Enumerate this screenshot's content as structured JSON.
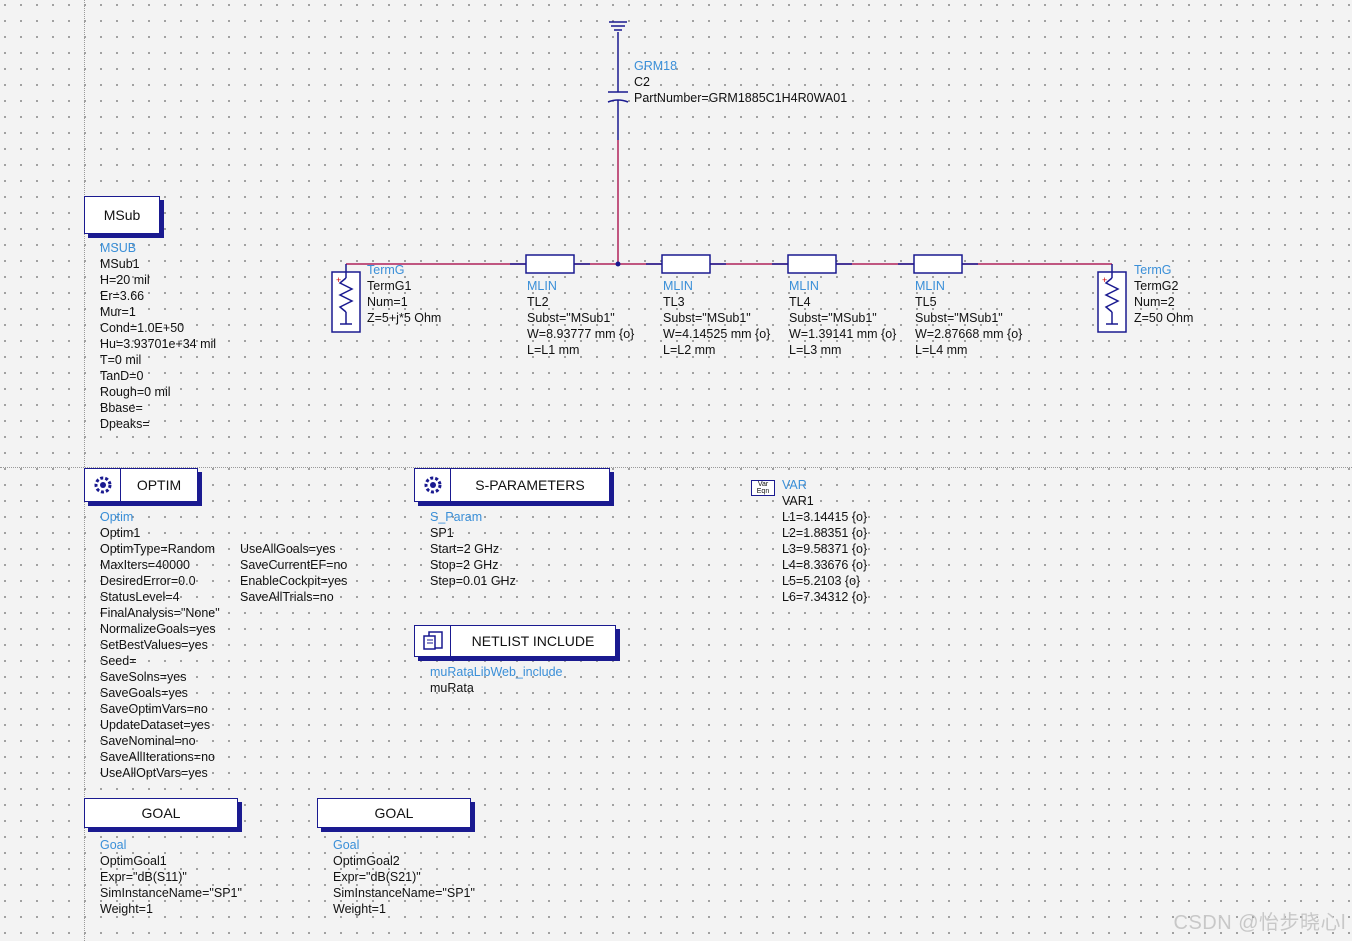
{
  "capacitor": {
    "lib": "GRM18",
    "name": "C2",
    "param": "PartNumber=GRM1885C1H4R0WA01"
  },
  "msub": {
    "box_label": "MSub",
    "lib": "MSUB",
    "name": "MSub1",
    "params": [
      "H=20 mil",
      "Er=3.66",
      "Mur=1",
      "Cond=1.0E+50",
      "Hu=3.93701e+34 mil",
      "T=0 mil",
      "TanD=0",
      "Rough=0 mil",
      "Bbase=",
      "Dpeaks="
    ]
  },
  "term1": {
    "lib": "TermG",
    "name": "TermG1",
    "params": [
      "Num=1",
      "Z=5+j*5 Ohm"
    ]
  },
  "term2": {
    "lib": "TermG",
    "name": "TermG2",
    "params": [
      "Num=2",
      "Z=50 Ohm"
    ]
  },
  "tl2": {
    "lib": "MLIN",
    "name": "TL2",
    "params": [
      "Subst=\"MSub1\"",
      "W=8.93777 mm {o}",
      "L=L1 mm"
    ]
  },
  "tl3": {
    "lib": "MLIN",
    "name": "TL3",
    "params": [
      "Subst=\"MSub1\"",
      "W=4.14525 mm {o}",
      "L=L2 mm"
    ]
  },
  "tl4": {
    "lib": "MLIN",
    "name": "TL4",
    "params": [
      "Subst=\"MSub1\"",
      "W=1.39141 mm {o}",
      "L=L3 mm"
    ]
  },
  "tl5": {
    "lib": "MLIN",
    "name": "TL5",
    "params": [
      "Subst=\"MSub1\"",
      "W=2.87668 mm {o}",
      "L=L4 mm"
    ]
  },
  "optim": {
    "box_label": "OPTIM",
    "lib": "Optim",
    "name": "Optim1",
    "col1": [
      "OptimType=Random",
      "MaxIters=40000",
      "DesiredError=0.0",
      "StatusLevel=4",
      "FinalAnalysis=\"None\"",
      "NormalizeGoals=yes",
      "SetBestValues=yes",
      "Seed=",
      "SaveSolns=yes",
      "SaveGoals=yes",
      "SaveOptimVars=no",
      "UpdateDataset=yes",
      "SaveNominal=no",
      "SaveAllIterations=no",
      "UseAllOptVars=yes"
    ],
    "col2": [
      "UseAllGoals=yes",
      "SaveCurrentEF=no",
      "EnableCockpit=yes",
      "SaveAllTrials=no"
    ]
  },
  "sparam": {
    "box_label": "S-PARAMETERS",
    "lib": "S_Param",
    "name": "SP1",
    "params": [
      "Start=2 GHz",
      "Stop=2 GHz",
      "Step=0.01 GHz"
    ]
  },
  "netlist": {
    "box_label": "NETLIST INCLUDE",
    "lib": "muRataLibWeb_include",
    "name": "muRata"
  },
  "var": {
    "icon_text": "Var Eqn",
    "lib": "VAR",
    "name": "VAR1",
    "params": [
      "L1=3.14415 {o}",
      "L2=1.88351 {o}",
      "L3=9.58371 {o}",
      "L4=8.33676 {o}",
      "L5=5.2103 {o}",
      "L6=7.34312 {o}"
    ]
  },
  "goal1": {
    "box_label": "GOAL",
    "lib": "Goal",
    "name": "OptimGoal1",
    "params": [
      "Expr=\"dB(S11)\"",
      "SimInstanceName=\"SP1\"",
      "Weight=1"
    ]
  },
  "goal2": {
    "box_label": "GOAL",
    "lib": "Goal",
    "name": "OptimGoal2",
    "params": [
      "Expr=\"dB(S21)\"",
      "SimInstanceName=\"SP1\"",
      "Weight=1"
    ]
  },
  "watermark": "CSDN @怡步晓心l",
  "colors": {
    "wire": "#b0225a",
    "box_border": "#1a1a90",
    "lib_text": "#3a8fd8",
    "component": "#1a1a90"
  }
}
